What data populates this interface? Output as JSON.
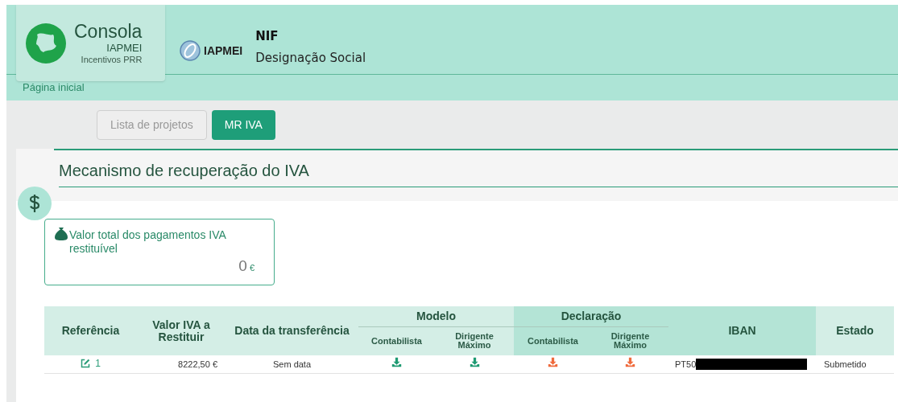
{
  "header": {
    "app_title": "Consola",
    "app_subtitle": "IAPMEI",
    "app_caption": "Incentivos PRR",
    "org_logo_text": "IAPMEI",
    "nif_label": "NIF",
    "company_label": "Designação Social"
  },
  "breadcrumb": "Página inicial",
  "tabs": [
    {
      "label": "Lista de projetos",
      "selected": false
    },
    {
      "label": "MR IVA",
      "selected": true
    }
  ],
  "section_title": "Mecanismo de recuperação do IVA",
  "summary_card": {
    "label": "Valor total dos pagamentos IVA restituível",
    "value": "0",
    "currency": "€"
  },
  "table": {
    "columns": [
      "Referência",
      "Valor IVA a Restituir",
      "Data da transferência"
    ],
    "groups": [
      {
        "label": "Modelo",
        "subcolumns": [
          "Contabilista",
          "Dirigente Máximo"
        ]
      },
      {
        "label": "Declaração",
        "subcolumns": [
          "Contabilista",
          "Dirigente Máximo"
        ]
      }
    ],
    "trailing_columns": [
      "IBAN",
      "Estado"
    ],
    "rows": [
      {
        "reference": "1",
        "value": "8222,50 €",
        "date": "Sem data",
        "downloads": [
          {
            "color": "#1e9a72"
          },
          {
            "color": "#1e9a72"
          },
          {
            "color": "#ef6a3c"
          },
          {
            "color": "#ef6a3c"
          }
        ],
        "iban": "PT50",
        "iban_redacted": true,
        "status": "Submetido"
      }
    ]
  }
}
